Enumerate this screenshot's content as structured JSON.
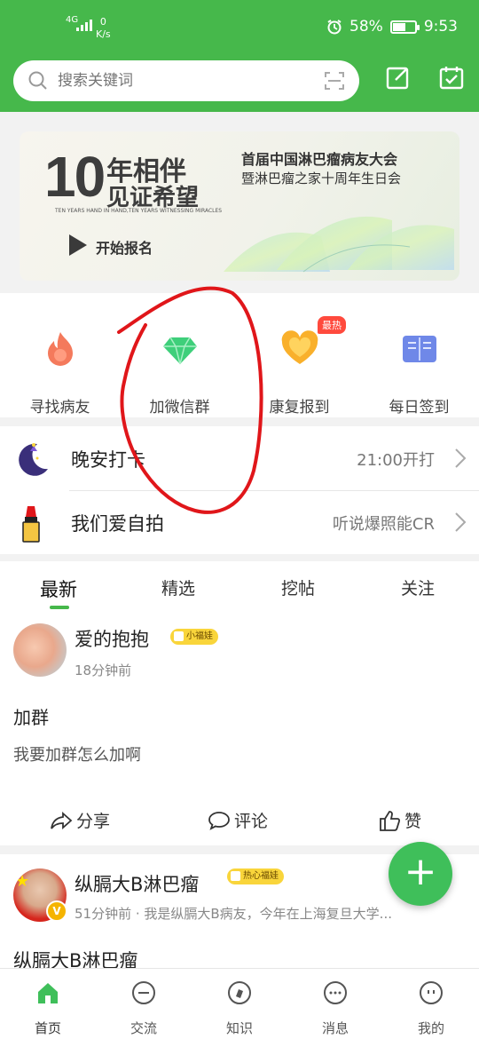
{
  "status_bar": {
    "network": "4G",
    "speed_value": "0",
    "speed_unit": "K/s",
    "battery": "58%",
    "battery_fraction": 0.58,
    "time": "9:53"
  },
  "search": {
    "placeholder": "搜索关键词"
  },
  "banner": {
    "big_number": "10",
    "line1": "年相伴",
    "line2": "见证希望",
    "small_text": "TEN YEARS HAND IN HAND,TEN YEARS WITNESSING MIRACLES",
    "cta": "开始报名",
    "title": "首届中国淋巴瘤病友大会",
    "subtitle": "暨淋巴瘤之家十周年生日会"
  },
  "quick_actions": [
    {
      "label": "寻找病友",
      "icon": "flame-icon"
    },
    {
      "label": "加微信群",
      "icon": "diamond-icon"
    },
    {
      "label": "康复报到",
      "icon": "heart-icon"
    },
    {
      "label": "每日签到",
      "icon": "book-icon"
    }
  ],
  "hot_badge": "最热",
  "checkins": [
    {
      "title": "晚安打卡",
      "right": "21:00开打",
      "icon": "moon-icon"
    },
    {
      "title": "我们爱自拍",
      "right": "听说爆照能CR",
      "icon": "lipstick-icon"
    }
  ],
  "feed_tabs": [
    "最新",
    "精选",
    "挖帖",
    "关注"
  ],
  "posts": [
    {
      "user": "爱的抱抱",
      "badge": "小福娃",
      "time": "18分钟前",
      "title": "加群",
      "body": "我要加群怎么加啊",
      "share": "分享",
      "comment": "评论",
      "like": "赞"
    },
    {
      "user": "纵膈大B淋巴瘤",
      "badge": "热心福娃",
      "meta": "51分钟前 · 我是纵膈大B病友，今年在上海复旦大学...",
      "title": "纵膈大B淋巴瘤"
    }
  ],
  "bottom_nav": [
    "首页",
    "交流",
    "知识",
    "消息",
    "我的"
  ],
  "colors": {
    "brand": "#46b84b",
    "fab": "#3fbf5a",
    "hot": "#ff4a3d",
    "annotation": "#e0161a"
  }
}
